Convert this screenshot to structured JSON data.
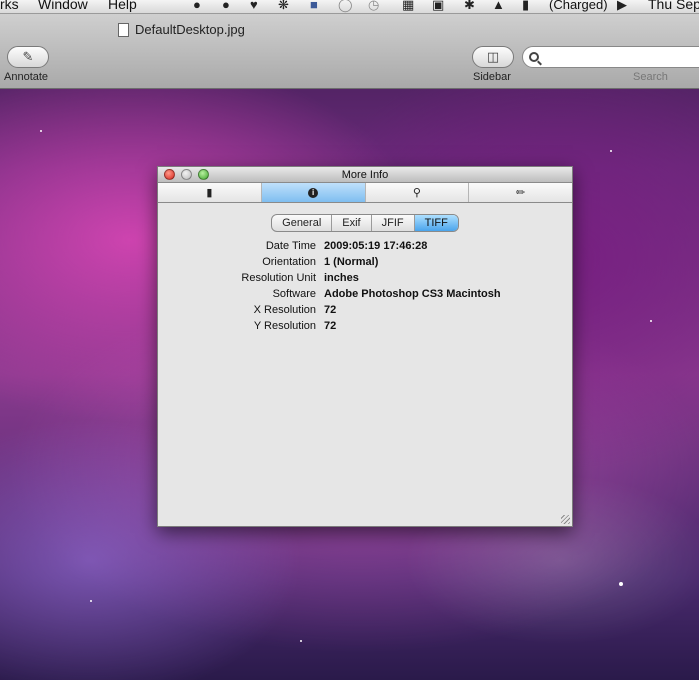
{
  "menubar": {
    "items": [
      "rks",
      "Window",
      "Help"
    ],
    "status": {
      "battery": "(Charged)",
      "clock": "Thu Sep"
    }
  },
  "toolbar": {
    "document_title": "DefaultDesktop.jpg",
    "annotate_label": "Annotate",
    "sidebar_label": "Sidebar",
    "search_placeholder": "",
    "search_label": "Search"
  },
  "panel": {
    "title": "More Info",
    "icon_tabs": [
      "document-icon",
      "info-icon",
      "magnifier-icon",
      "pencil-icon"
    ],
    "active_icon_tab": 1,
    "segments": [
      "General",
      "Exif",
      "JFIF",
      "TIFF"
    ],
    "active_segment": 3,
    "properties": [
      {
        "key": "Date Time",
        "value": "2009:05:19 17:46:28"
      },
      {
        "key": "Orientation",
        "value": "1 (Normal)"
      },
      {
        "key": "Resolution Unit",
        "value": "inches"
      },
      {
        "key": "Software",
        "value": "Adobe Photoshop CS3 Macintosh"
      },
      {
        "key": "X Resolution",
        "value": "72"
      },
      {
        "key": "Y Resolution",
        "value": "72"
      }
    ]
  }
}
